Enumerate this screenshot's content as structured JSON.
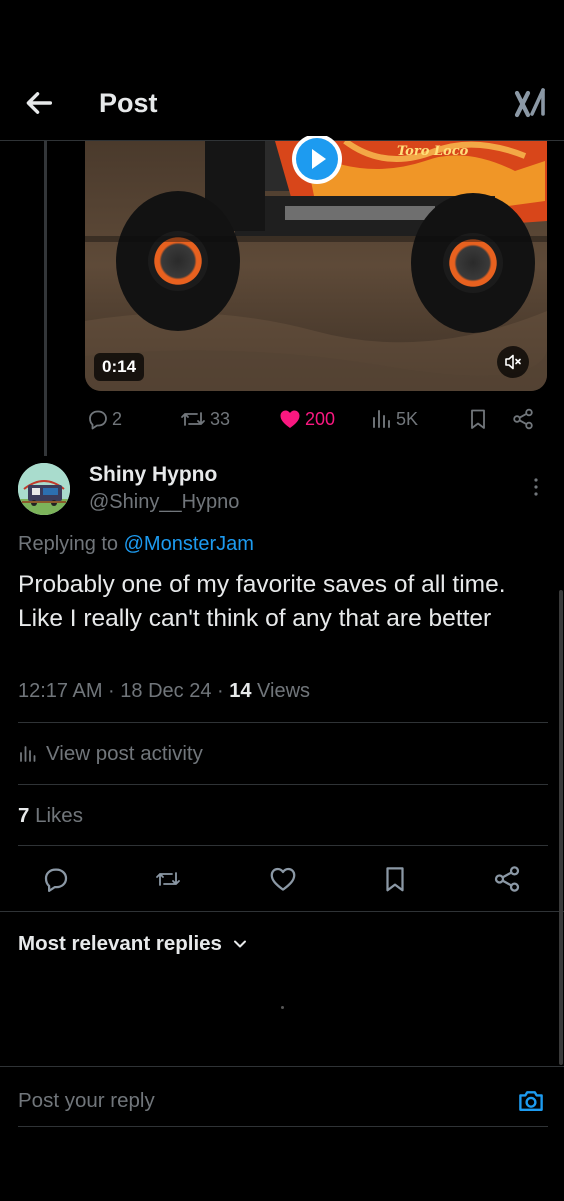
{
  "header": {
    "title": "Post",
    "back_icon": "arrow-left-icon",
    "logo_icon": "x-grok-logo-icon"
  },
  "parent_post": {
    "video": {
      "duration": "0:14",
      "muted": true,
      "truck_text": "Toro Loco"
    },
    "stats": {
      "replies": "2",
      "reposts": "33",
      "likes": "200",
      "views": "5K",
      "liked": true
    },
    "colors": {
      "like": "#f91880",
      "play": "#1d9bf0"
    }
  },
  "reply": {
    "display_name": "Shiny Hypno",
    "handle": "@Shiny__Hypno",
    "replying_prefix": "Replying to",
    "replying_to": "@MonsterJam",
    "text": "Probably one of my favorite saves of all time. Like I really can't think of any that are better",
    "time": "12:17 AM · 18 Dec 24 · ",
    "views_count": "14",
    "views_label": " Views",
    "activity_label": "View post activity",
    "likes_count": "7",
    "likes_label": " Likes"
  },
  "replies_section": {
    "sort_label": "Most relevant replies"
  },
  "composer": {
    "placeholder": "Post your reply",
    "camera_icon": "camera-icon"
  },
  "accent": "#1d9bf0"
}
